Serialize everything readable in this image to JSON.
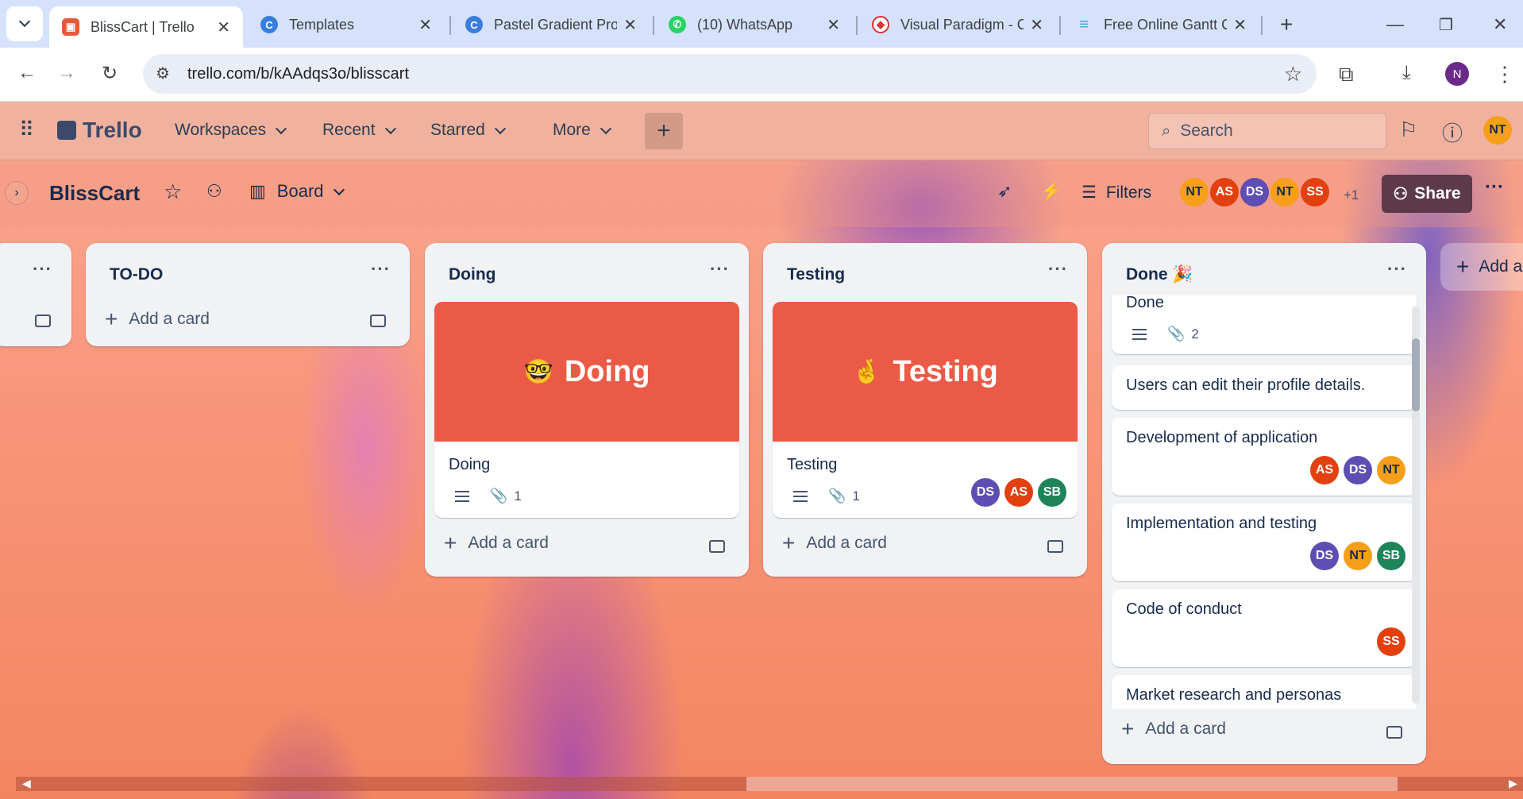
{
  "browser": {
    "tabs": [
      {
        "title": "BlissCart | Trello",
        "icon": "trello-icon",
        "active": true
      },
      {
        "title": "Templates",
        "icon": "canva-icon"
      },
      {
        "title": "Pastel Gradient Pro",
        "icon": "canva-icon"
      },
      {
        "title": "(10) WhatsApp",
        "icon": "whatsapp-icon"
      },
      {
        "title": "Visual Paradigm - C",
        "icon": "visual-paradigm-icon"
      },
      {
        "title": "Free Online Gantt C",
        "icon": "gantt-icon"
      }
    ],
    "url": "trello.com/b/kAAdqs3o/blisscart",
    "profile_initial": "N"
  },
  "app_header": {
    "logo": "Trello",
    "nav": [
      "Workspaces",
      "Recent",
      "Starred",
      "More"
    ],
    "create_label": "+",
    "search_placeholder": "Search",
    "user_initials": "NT"
  },
  "board": {
    "name": "BlissCart",
    "view": "Board",
    "filters_label": "Filters",
    "share_label": "Share",
    "member_more": "+1",
    "members": [
      {
        "initials": "NT",
        "color": "#f79e1b"
      },
      {
        "initials": "AS",
        "color": "#e2400f"
      },
      {
        "initials": "DS",
        "color": "#5e4db2"
      },
      {
        "initials": "NT",
        "color": "#f79e1b"
      },
      {
        "initials": "SS",
        "color": "#e2400f"
      }
    ]
  },
  "lists": {
    "todo": {
      "title": "TO-DO",
      "add_card": "Add a card"
    },
    "doing": {
      "title": "Doing",
      "add_card": "Add a card",
      "card": {
        "cover_emoji": "🤓",
        "cover_text": "Doing",
        "title": "Doing",
        "attachments": "1"
      }
    },
    "testing": {
      "title": "Testing",
      "add_card": "Add a card",
      "card": {
        "cover_emoji": "🤞",
        "cover_text": "Testing",
        "title": "Testing",
        "attachments": "1",
        "members": [
          "DS",
          "AS",
          "SB"
        ]
      }
    },
    "done": {
      "title": "Done 🎉",
      "add_card": "Add a card",
      "cards": [
        {
          "title": "Done",
          "attachments": "2"
        },
        {
          "title": "Users can edit their profile details."
        },
        {
          "title": "Development of application",
          "members": [
            "AS",
            "DS",
            "NT"
          ]
        },
        {
          "title": "Implementation and testing",
          "members": [
            "DS",
            "NT",
            "SB"
          ]
        },
        {
          "title": "Code of conduct",
          "members": [
            "SS"
          ]
        },
        {
          "title": "Market research and personas"
        }
      ]
    },
    "add_another": "Add a"
  },
  "colors": {
    "AS": "#e2400f",
    "DS": "#5e4db2",
    "NT": "#f79e1b",
    "SB": "#1f845a",
    "SS": "#e2400f",
    "cover_red": "#eb5a46",
    "share_bg": "#5c3a49"
  }
}
